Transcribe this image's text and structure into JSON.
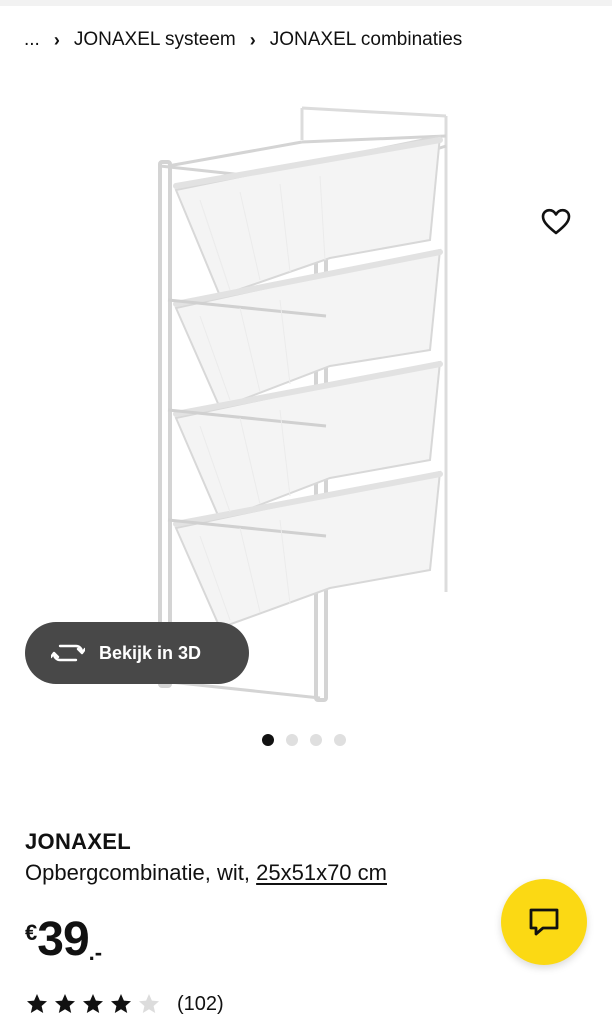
{
  "breadcrumb": {
    "ellipsis": "...",
    "separator": "›",
    "items": [
      {
        "label": "JONAXEL systeem"
      },
      {
        "label": "JONAXEL combinaties"
      }
    ]
  },
  "gallery": {
    "image_alt": "JONAXEL opbergcombinatie met 4 draadmanden",
    "view_3d_label": "Bekijk in 3D",
    "current_image": 1,
    "total_images": 4,
    "favorite_icon": "heart-icon",
    "rotate_icon": "rotate-3d-icon"
  },
  "product": {
    "name": "JONAXEL",
    "description": "Opbergcombinatie, wit,",
    "dimensions": "25x51x70 cm",
    "price": {
      "currency": "€",
      "amount": "39",
      "suffix": ".-"
    },
    "rating": {
      "value": 4,
      "max": 5,
      "count": "(102)"
    }
  },
  "chat": {
    "icon": "chat-bubble-icon"
  },
  "colors": {
    "accent_yellow": "#fbd914",
    "button_dark": "#484848",
    "text": "#111111"
  }
}
